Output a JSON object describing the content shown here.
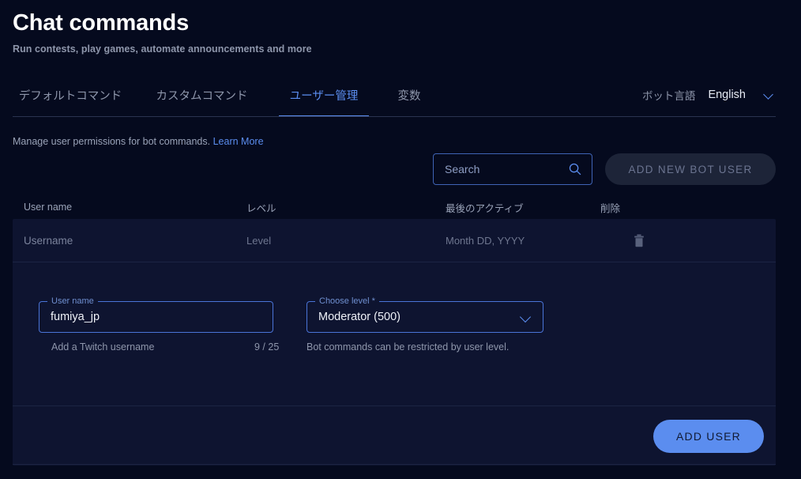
{
  "header": {
    "title": "Chat commands",
    "subtitle": "Run contests, play games, automate announcements and more"
  },
  "tabs": [
    {
      "label": "デフォルトコマンド",
      "active": false
    },
    {
      "label": "カスタムコマンド",
      "active": false
    },
    {
      "label": "ユーザー管理",
      "active": true
    },
    {
      "label": "変数",
      "active": false
    }
  ],
  "bot_language": {
    "label": "ボット言語",
    "value": "English",
    "chevron_icon": "chevron-down-icon"
  },
  "toolbar": {
    "description": "Manage user permissions for bot commands.",
    "learn_more": "Learn More",
    "search_placeholder": "Search",
    "search_value": "",
    "search_icon": "search-icon",
    "add_new_bot_user": "ADD NEW BOT USER",
    "add_new_bot_user_disabled": true
  },
  "table": {
    "headers": [
      "User name",
      "レベル",
      "最後のアクティブ",
      "削除"
    ],
    "placeholder_row": {
      "username": "Username",
      "level": "Level",
      "last_active": "Month DD, YYYY",
      "delete_icon": "trash-icon"
    }
  },
  "form": {
    "username": {
      "label": "User name",
      "value": "fumiya_jp",
      "helper": "Add a Twitch username",
      "counter": "9 / 25"
    },
    "level": {
      "label": "Choose level *",
      "value": "Moderator (500)",
      "helper": "Bot commands can be restricted by user level.",
      "chevron_icon": "chevron-down-icon"
    },
    "submit_label": "ADD USER"
  },
  "colors": {
    "background": "#050a1e",
    "card": "#0e1430",
    "accent": "#5b8def",
    "muted_text": "#8e96ab",
    "border": "#2a3350"
  }
}
